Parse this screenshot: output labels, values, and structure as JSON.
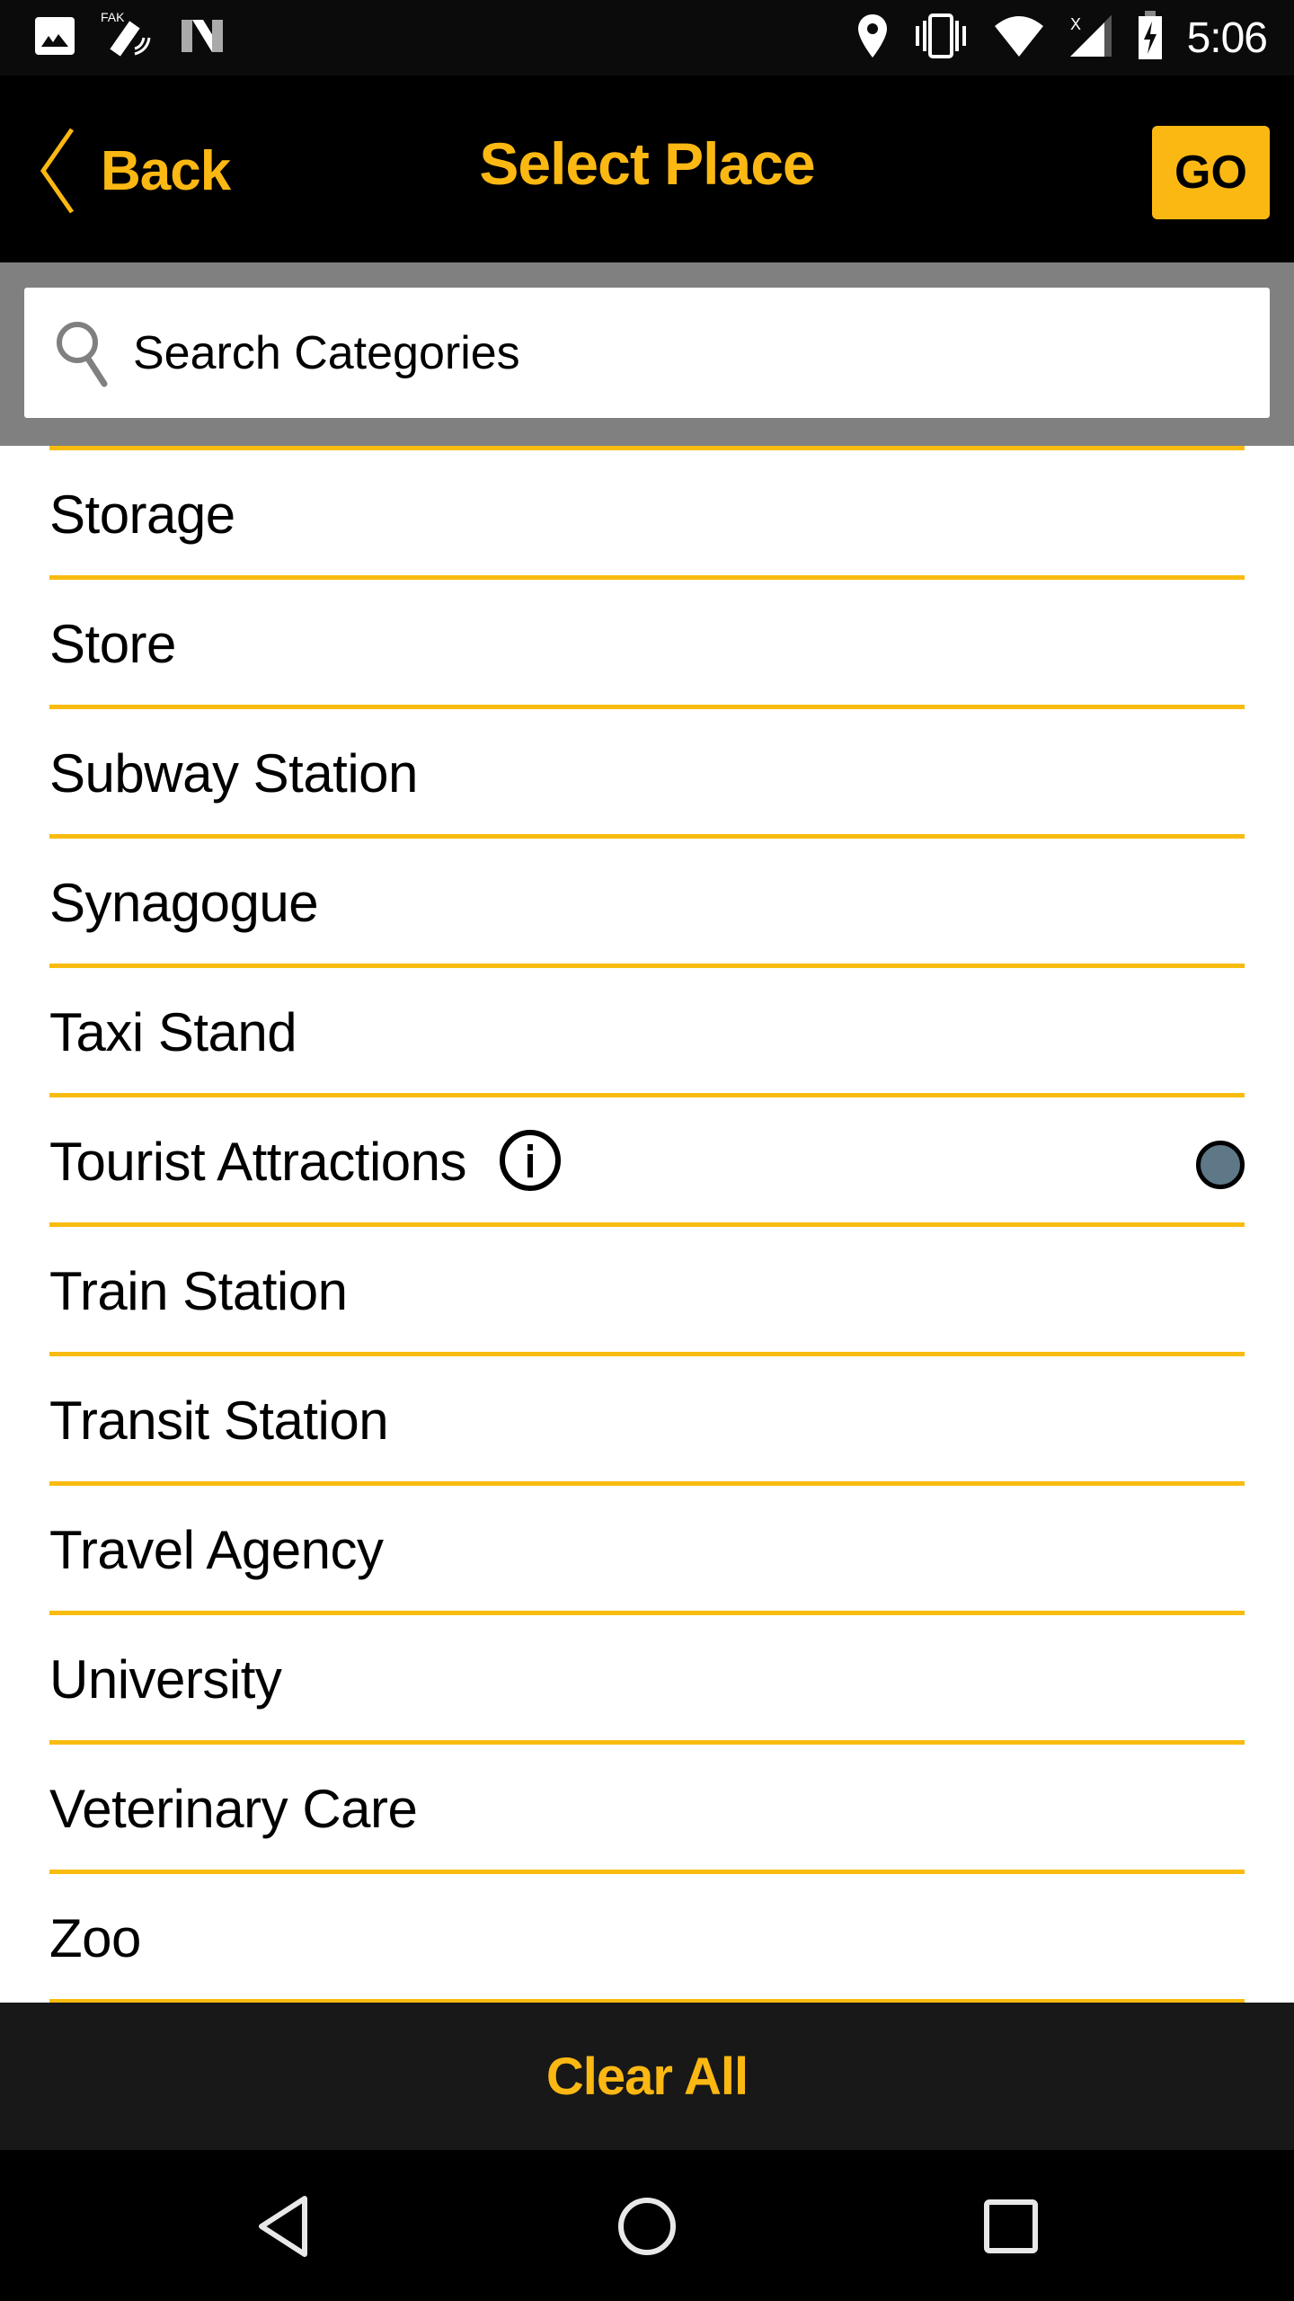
{
  "status_bar": {
    "left_icons": [
      "image-notification-icon",
      "fake-gps-satellite-icon",
      "n-app-icon"
    ],
    "right_icons": [
      "location-pin-icon",
      "vibrate-icon",
      "wifi-icon",
      "cell-signal-no-data-icon",
      "battery-charging-icon"
    ],
    "time": "5:06"
  },
  "header": {
    "back_label": "Back",
    "title": "Select Place",
    "go_label": "GO"
  },
  "search": {
    "placeholder": "Search Categories",
    "value": ""
  },
  "categories": [
    {
      "label": "Storage",
      "info": false,
      "selected": false
    },
    {
      "label": "Store",
      "info": false,
      "selected": false
    },
    {
      "label": "Subway Station",
      "info": false,
      "selected": false
    },
    {
      "label": "Synagogue",
      "info": false,
      "selected": false
    },
    {
      "label": "Taxi Stand",
      "info": false,
      "selected": false
    },
    {
      "label": "Tourist Attractions",
      "info": true,
      "selected": true
    },
    {
      "label": "Train Station",
      "info": false,
      "selected": false
    },
    {
      "label": "Transit Station",
      "info": false,
      "selected": false
    },
    {
      "label": "Travel Agency",
      "info": false,
      "selected": false
    },
    {
      "label": "University",
      "info": false,
      "selected": false
    },
    {
      "label": "Veterinary Care",
      "info": false,
      "selected": false
    },
    {
      "label": "Zoo",
      "info": false,
      "selected": false
    }
  ],
  "footer": {
    "clear_all_label": "Clear All"
  },
  "nav": {
    "buttons": [
      "back",
      "home",
      "recents"
    ]
  },
  "colors": {
    "accent": "#fbb813",
    "divider": "#f8bb0f",
    "selected_dot": "#5e7887",
    "header_bg": "#000000",
    "search_panel_bg": "#808080",
    "footer_bg": "#181818"
  }
}
